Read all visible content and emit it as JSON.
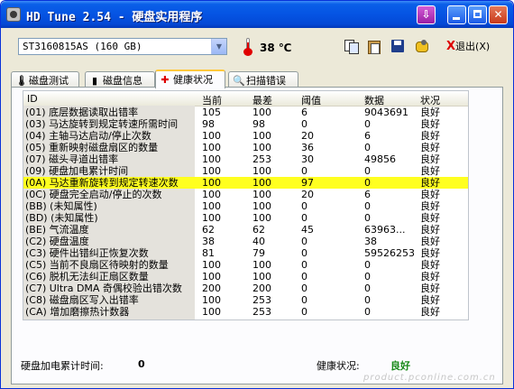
{
  "window": {
    "title": "HD Tune 2.54 - 硬盘实用程序"
  },
  "toolbar": {
    "drive": "ST3160815AS (160 GB)",
    "temperature": "38 ℃",
    "exit_label": "退出(X)",
    "exit_prefix": "X"
  },
  "tabs": [
    {
      "label": "磁盘测试",
      "icon": "ruler-icon"
    },
    {
      "label": "磁盘信息",
      "icon": "info-icon"
    },
    {
      "label": "健康状况",
      "icon": "health-cross-icon"
    },
    {
      "label": "扫描错误",
      "icon": "magnifier-icon"
    }
  ],
  "table": {
    "headers": [
      "ID",
      "当前",
      "最差",
      "阈值",
      "数据",
      "状况"
    ],
    "rows": [
      [
        "(01) 底层数据读取出错率",
        "105",
        "100",
        "6",
        "9043691",
        "良好"
      ],
      [
        "(03) 马达旋转到规定转速所需时间",
        "98",
        "98",
        "0",
        "0",
        "良好"
      ],
      [
        "(04) 主轴马达启动/停止次数",
        "100",
        "100",
        "20",
        "6",
        "良好"
      ],
      [
        "(05) 重新映射磁盘扇区的数量",
        "100",
        "100",
        "36",
        "0",
        "良好"
      ],
      [
        "(07) 磁头寻道出错率",
        "100",
        "253",
        "30",
        "49856",
        "良好"
      ],
      [
        "(09) 硬盘加电累计时间",
        "100",
        "100",
        "0",
        "0",
        "良好"
      ],
      [
        "(0A) 马达重新旋转到规定转速次数",
        "100",
        "100",
        "97",
        "0",
        "良好"
      ],
      [
        "(0C) 硬盘完全启动/停止的次数",
        "100",
        "100",
        "20",
        "6",
        "良好"
      ],
      [
        "(BB) (未知属性)",
        "100",
        "100",
        "0",
        "0",
        "良好"
      ],
      [
        "(BD) (未知属性)",
        "100",
        "100",
        "0",
        "0",
        "良好"
      ],
      [
        "(BE) 气流温度",
        "62",
        "62",
        "45",
        "63963...",
        "良好"
      ],
      [
        "(C2) 硬盘温度",
        "38",
        "40",
        "0",
        "38",
        "良好"
      ],
      [
        "(C3) 硬件出错纠正恢复次数",
        "81",
        "79",
        "0",
        "59526253",
        "良好"
      ],
      [
        "(C5) 当前不良扇区待映射的数量",
        "100",
        "100",
        "0",
        "0",
        "良好"
      ],
      [
        "(C6) 脱机无法纠正扇区数量",
        "100",
        "100",
        "0",
        "0",
        "良好"
      ],
      [
        "(C7) Ultra DMA 奇偶校验出错次数",
        "200",
        "200",
        "0",
        "0",
        "良好"
      ],
      [
        "(C8) 磁盘扇区写入出错率",
        "100",
        "253",
        "0",
        "0",
        "良好"
      ],
      [
        "(CA) 增加磨擦热计数器",
        "100",
        "253",
        "0",
        "0",
        "良好"
      ]
    ],
    "highlighted_row": 6,
    "highlight_color": "#ffff20"
  },
  "status": {
    "power_on_label": "硬盘加电累计时间:",
    "power_on_value": "0",
    "health_label": "健康状况:",
    "health_value": "良好",
    "health_color": "#1a8a1a"
  },
  "watermark": "product.pconline.com.cn"
}
